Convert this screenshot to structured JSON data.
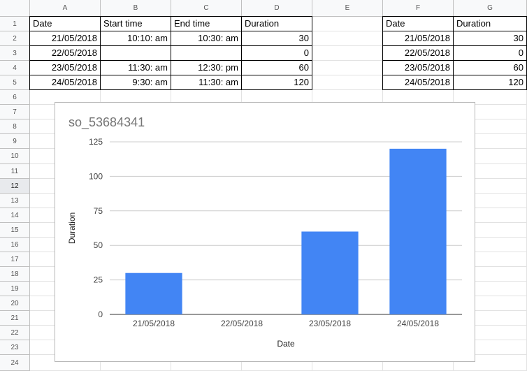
{
  "columns": [
    "A",
    "B",
    "C",
    "D",
    "E",
    "F",
    "G"
  ],
  "rows": [
    "1",
    "2",
    "3",
    "4",
    "5",
    "6",
    "7",
    "8",
    "9",
    "10",
    "11",
    "12",
    "13",
    "14",
    "15",
    "16",
    "17",
    "18",
    "19",
    "20",
    "21",
    "22",
    "23",
    "24"
  ],
  "selected_row": "12",
  "table1": {
    "headers": [
      "Date",
      "Start time",
      "End time",
      "Duration"
    ],
    "rows": [
      [
        "21/05/2018",
        "10:10: am",
        "10:30: am",
        "30"
      ],
      [
        "22/05/2018",
        "",
        "",
        "0"
      ],
      [
        "23/05/2018",
        "11:30: am",
        "12:30: pm",
        "60"
      ],
      [
        "24/05/2018",
        "9:30: am",
        "11:30: am",
        "120"
      ]
    ]
  },
  "table2": {
    "headers": [
      "Date",
      "Duration"
    ],
    "rows": [
      [
        "21/05/2018",
        "30"
      ],
      [
        "22/05/2018",
        "0"
      ],
      [
        "23/05/2018",
        "60"
      ],
      [
        "24/05/2018",
        "120"
      ]
    ]
  },
  "chart_data": {
    "type": "bar",
    "title": "so_53684341",
    "categories": [
      "21/05/2018",
      "22/05/2018",
      "23/05/2018",
      "24/05/2018"
    ],
    "values": [
      30,
      0,
      60,
      120
    ],
    "xlabel": "Date",
    "ylabel": "Duration",
    "ylim": [
      0,
      125
    ],
    "yticks": [
      "0",
      "25",
      "50",
      "75",
      "100",
      "125"
    ],
    "grid": true,
    "bar_color": "#4285f4"
  }
}
